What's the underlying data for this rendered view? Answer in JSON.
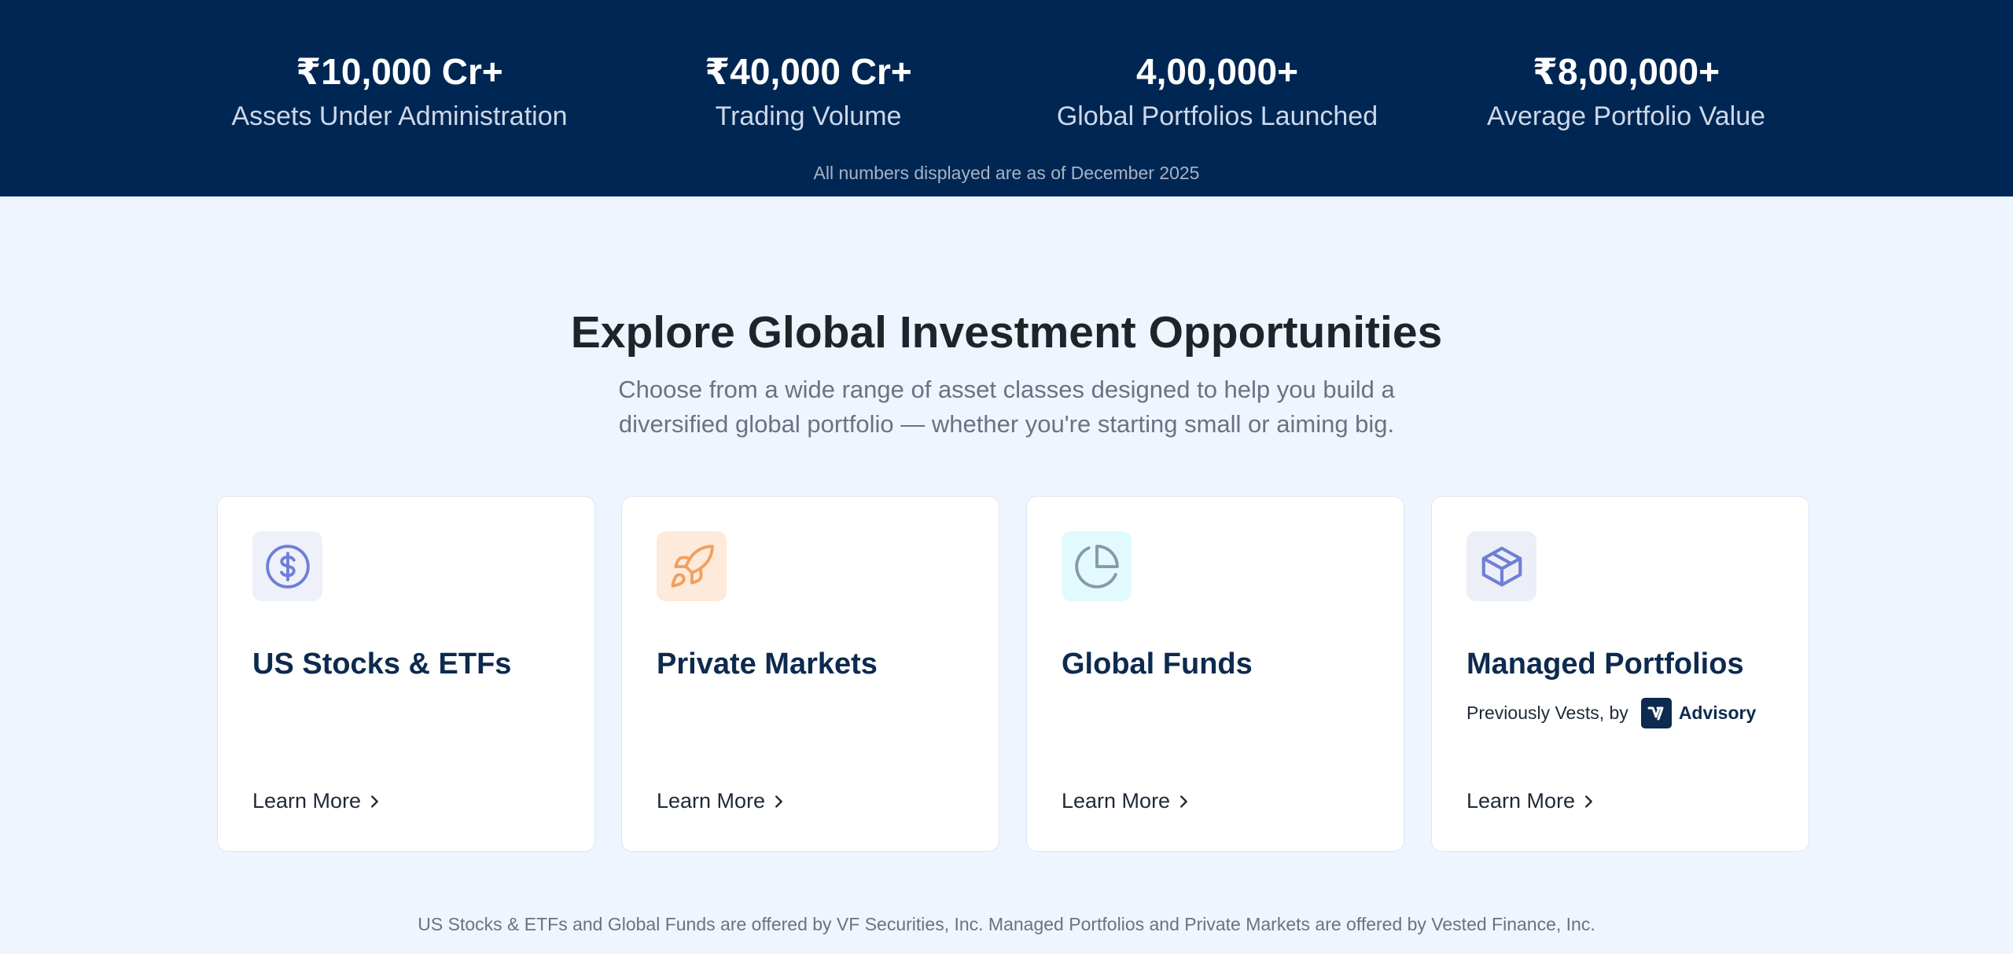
{
  "stats": {
    "items": [
      {
        "value": "₹10,000 Cr+",
        "label": "Assets Under Administration"
      },
      {
        "value": "₹40,000 Cr+",
        "label": "Trading Volume"
      },
      {
        "value": "4,00,000+",
        "label": "Global Portfolios Launched"
      },
      {
        "value": "₹8,00,000+",
        "label": "Average Portfolio Value"
      }
    ],
    "note": "All numbers displayed are as of December 2025"
  },
  "section": {
    "title": "Explore Global Investment Opportunities",
    "subtitle": "Choose from a wide range of asset classes designed to help you build a diversified global portfolio — whether you're starting small or aiming big."
  },
  "cards": [
    {
      "title": "US Stocks & ETFs",
      "link": "Learn More",
      "icon": "dollar-circle-icon",
      "icon_bg": "#eef1fa",
      "icon_color": "#6f7fd6"
    },
    {
      "title": "Private Markets",
      "link": "Learn More",
      "icon": "rocket-icon",
      "icon_bg": "#feeadb",
      "icon_color": "#f0a060"
    },
    {
      "title": "Global Funds",
      "link": "Learn More",
      "icon": "pie-chart-icon",
      "icon_bg": "#e0fafe",
      "icon_color": "#8a98a6"
    },
    {
      "title": "Managed Portfolios",
      "subtitle_prefix": "Previously Vests, by",
      "subtitle_brand": "Advisory",
      "link": "Learn More",
      "icon": "box-icon",
      "icon_bg": "#eceff8",
      "icon_color": "#6f7fd6"
    }
  ],
  "disclaimer": "US Stocks & ETFs and Global Funds are offered by VF Securities, Inc. Managed Portfolios and Private Markets are offered by Vested Finance, Inc.",
  "colors": {
    "banner_bg": "#002653",
    "page_bg": "#eef5ff",
    "card_title": "#0d2a4f"
  }
}
